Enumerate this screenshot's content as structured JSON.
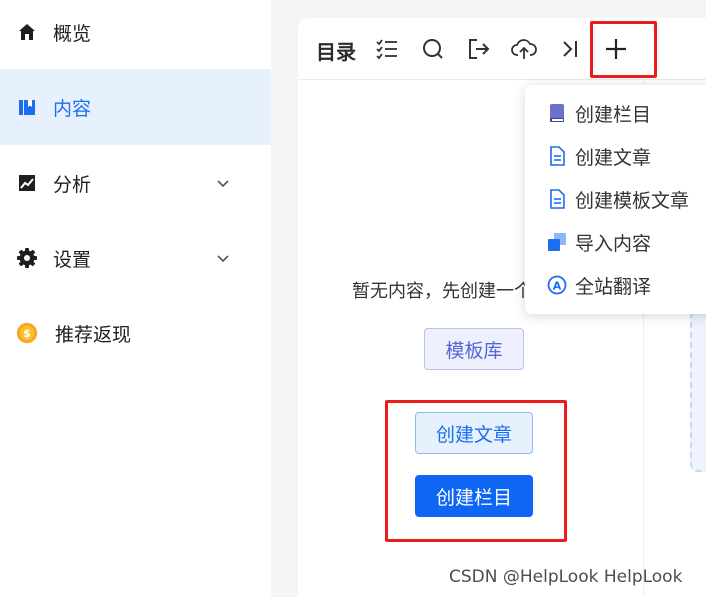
{
  "sidebar": {
    "items": [
      {
        "label": "概览",
        "icon": "home-icon",
        "active": false
      },
      {
        "label": "内容",
        "icon": "book-icon",
        "active": true
      },
      {
        "label": "分析",
        "icon": "chart-icon",
        "active": false,
        "expandable": true
      },
      {
        "label": "设置",
        "icon": "gear-icon",
        "active": false,
        "expandable": true
      },
      {
        "label": "推荐返现",
        "icon": "coin-icon",
        "active": false
      }
    ]
  },
  "toolbar": {
    "title": "目录",
    "buttons": [
      "checklist-icon",
      "search-icon",
      "export-icon",
      "upload-icon",
      "collapse-icon",
      "plus-icon"
    ]
  },
  "main": {
    "empty_text": "暂无内容，先创建一个",
    "template_button": "模板库",
    "create_article_button": "创建文章",
    "create_column_button": "创建栏目"
  },
  "dropdown": {
    "items": [
      {
        "label": "创建栏目",
        "icon": "column-book-icon"
      },
      {
        "label": "创建文章",
        "icon": "document-icon"
      },
      {
        "label": "创建模板文章",
        "icon": "template-document-icon"
      },
      {
        "label": "导入内容",
        "icon": "import-icon"
      },
      {
        "label": "全站翻译",
        "icon": "translate-icon"
      }
    ]
  },
  "colors": {
    "accent": "#0f66f5",
    "active_bg": "#e7f0fd",
    "highlight": "#ec1c1c"
  },
  "watermark": "CSDN @HelpLook HelpLook"
}
